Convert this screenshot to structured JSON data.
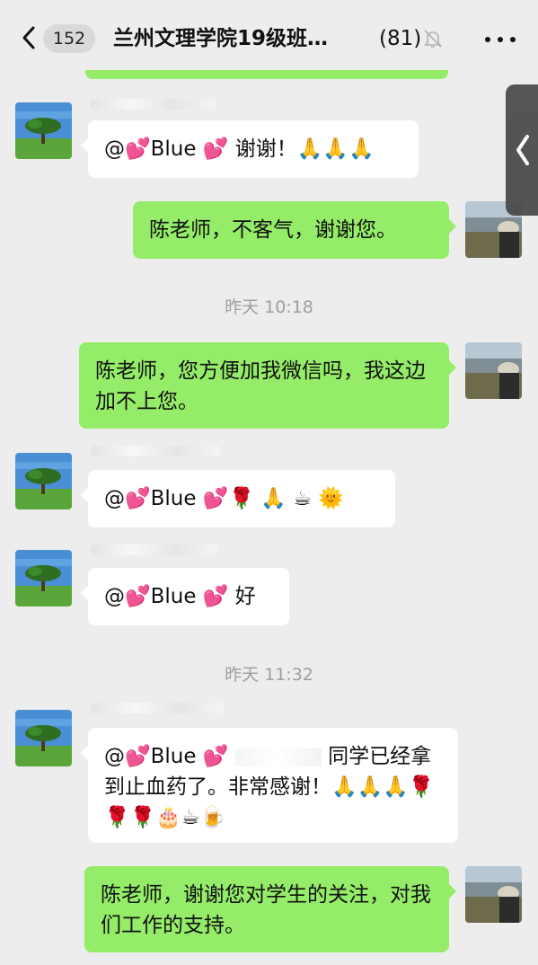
{
  "header": {
    "badge_count": "152",
    "title": "兰州文理学院19级班…",
    "member_count": "(81)"
  },
  "messages": [
    {
      "id": "m1",
      "text": "@💕Blue 💕 谢谢！🙏🙏🙏"
    },
    {
      "id": "m2",
      "text": "陈老师，不客气，谢谢您。"
    },
    {
      "id": "m3",
      "text": "陈老师，您方便加我微信吗，我这边加不上您。"
    },
    {
      "id": "m4",
      "text": "@💕Blue 💕🌹 🙏 ☕ 🌞"
    },
    {
      "id": "m5",
      "text": "@💕Blue 💕 好"
    },
    {
      "id": "m6_a",
      "text": "@💕Blue 💕"
    },
    {
      "id": "m6_b",
      "text": "同学已经拿到止血药了。非常感谢！🙏🙏🙏🌹🌹🌹🎂☕🍺"
    },
    {
      "id": "m7",
      "text": "陈老师，谢谢您对学生的关注，对我们工作的支持。"
    }
  ],
  "timestamps": {
    "t1": "昨天 10:18",
    "t2": "昨天 11:32"
  },
  "icons": {
    "back": "chevron-left-icon",
    "mute": "bell-off-icon",
    "more": "more-horizontal-icon",
    "side": "chevron-left-thin-icon"
  },
  "colors": {
    "outgoing_bubble": "#95ec69",
    "incoming_bubble": "#ffffff",
    "background": "#ededed"
  }
}
